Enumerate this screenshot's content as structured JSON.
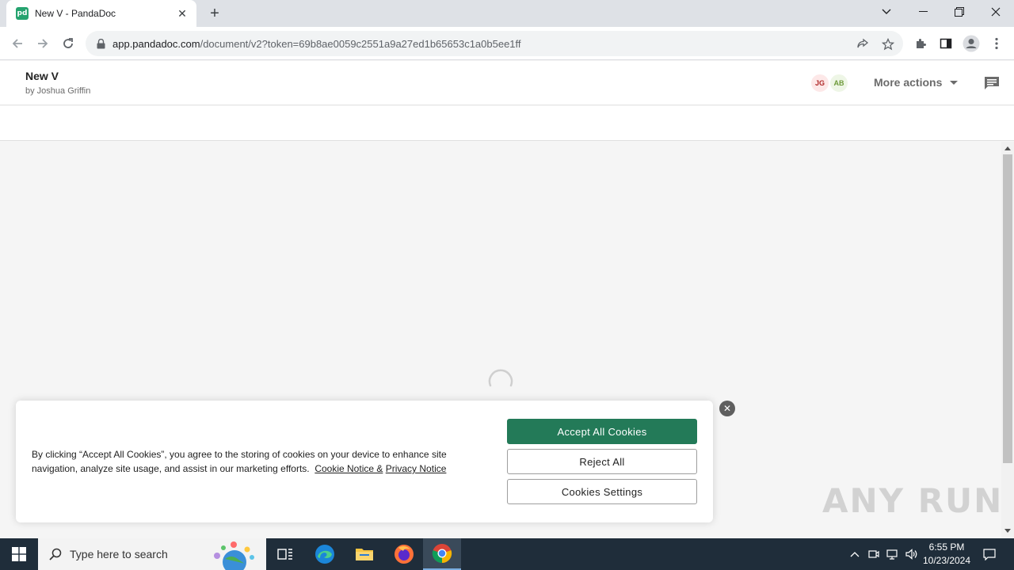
{
  "browser": {
    "tab_title": "New V - PandaDoc",
    "favicon_text": "pd",
    "url_host": "app.pandadoc.com",
    "url_path": "/document/v2?token=69b8ae0059c2551a9a27ed1b65653c1a0b5ee1ff"
  },
  "header": {
    "doc_title": "New V",
    "doc_author": "by Joshua Griffin",
    "avatars": [
      {
        "initials": "JG",
        "bg": "#fde8e8",
        "fg": "#b02a2a"
      },
      {
        "initials": "AB",
        "bg": "#eef6e6",
        "fg": "#6e9a3a"
      }
    ],
    "more_actions": "More actions"
  },
  "cookie": {
    "text_main": "By clicking “Accept All Cookies”, you agree to the storing of cookies on your device to enhance site navigation, analyze site usage, and assist in our marketing efforts.",
    "link_cookie": "Cookie Notice &",
    "link_privacy": "Privacy Notice",
    "accept": "Accept All Cookies",
    "reject": "Reject All",
    "settings": "Cookies Settings"
  },
  "watermark": "ANY RUN",
  "taskbar": {
    "search_placeholder": "Type here to search",
    "time": "6:55 PM",
    "date": "10/23/2024"
  },
  "colors": {
    "accent_green": "#237a58",
    "taskbar": "#1f2d3a"
  }
}
